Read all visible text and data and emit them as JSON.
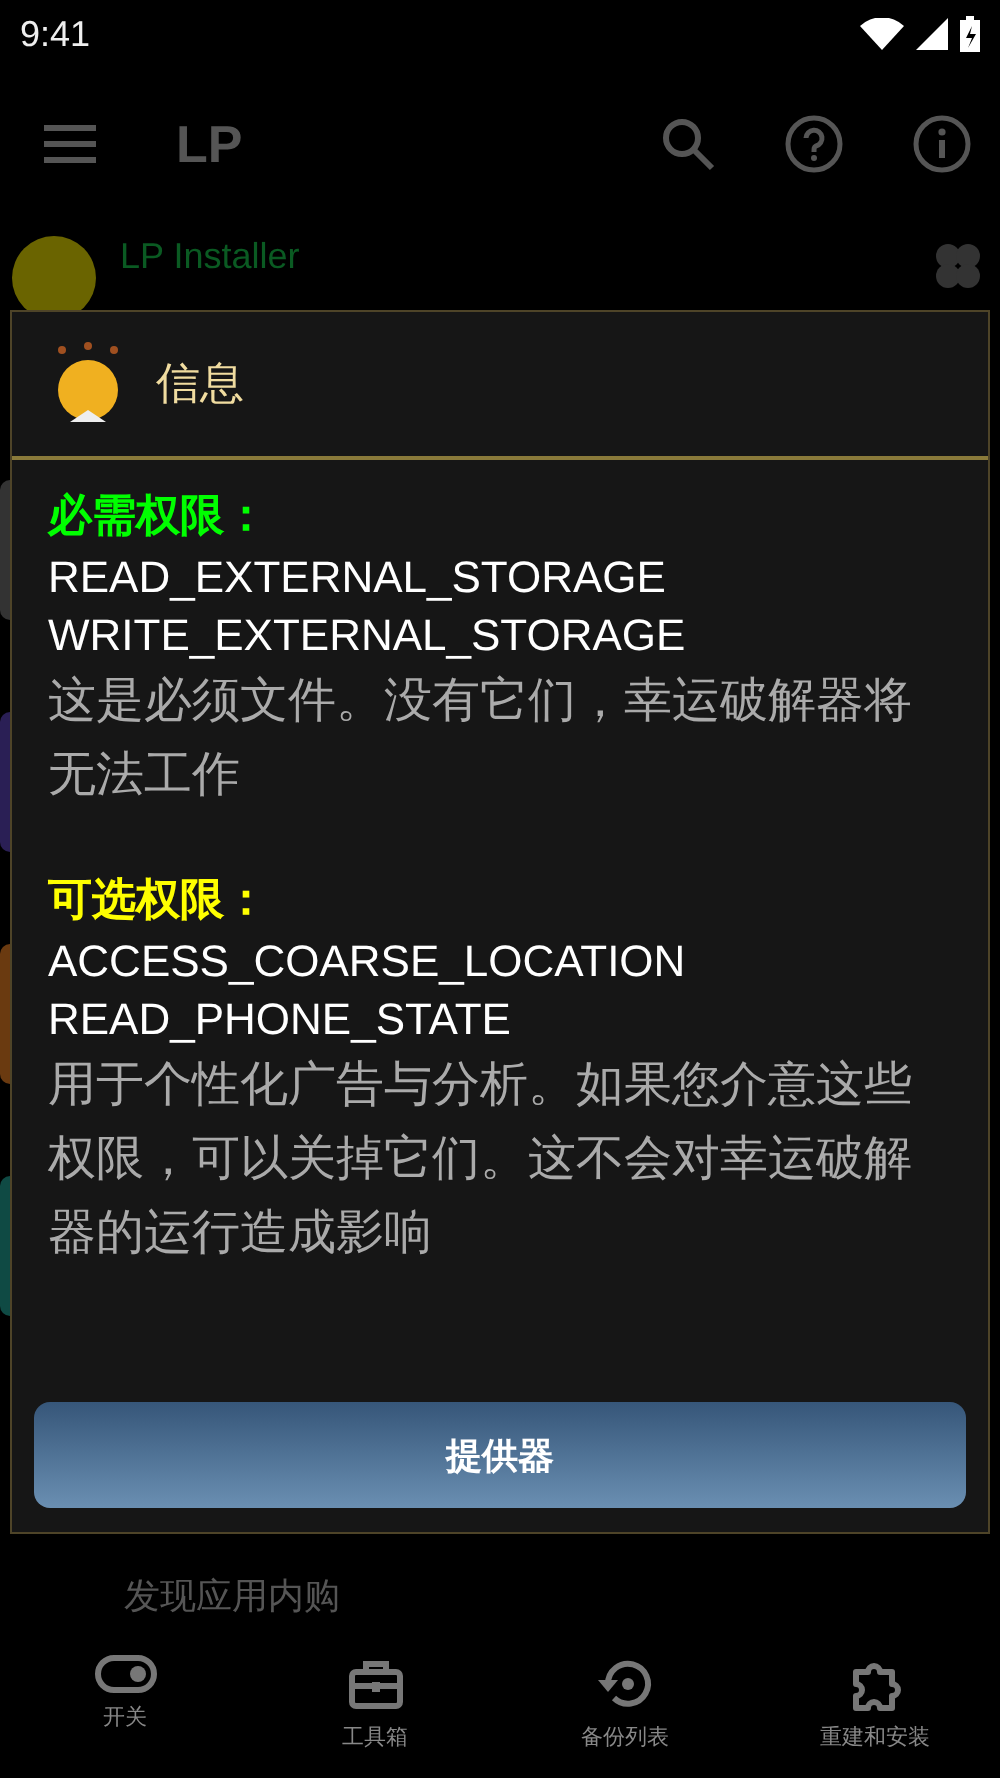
{
  "status_bar": {
    "time": "9:41"
  },
  "app_bar": {
    "title": "LP"
  },
  "list_items": [
    {
      "title": "LP  Installer"
    },
    {
      "details": [
        "发现应用内购"
      ]
    }
  ],
  "dialog": {
    "title": "信息",
    "sections": [
      {
        "heading": "必需权限：",
        "color": "#00ff00",
        "permissions": [
          "READ_EXTERNAL_STORAGE",
          "WRITE_EXTERNAL_STORAGE"
        ],
        "description": "这是必须文件。没有它们，幸运破解器将无法工作"
      },
      {
        "heading": "可选权限：",
        "color": "#ffff00",
        "permissions": [
          "ACCESS_COARSE_LOCATION",
          "READ_PHONE_STATE"
        ],
        "description": "用于个性化广告与分析。如果您介意这些权限，可以关掉它们。这不会对幸运破解器的运行造成影响"
      }
    ],
    "button": "提供器"
  },
  "bottom_nav": [
    {
      "kind": "toggle",
      "label": "开关"
    },
    {
      "kind": "toolbox",
      "label": "工具箱"
    },
    {
      "kind": "backup",
      "label": "备份列表"
    },
    {
      "kind": "puzzle",
      "label": "重建和安装"
    }
  ]
}
